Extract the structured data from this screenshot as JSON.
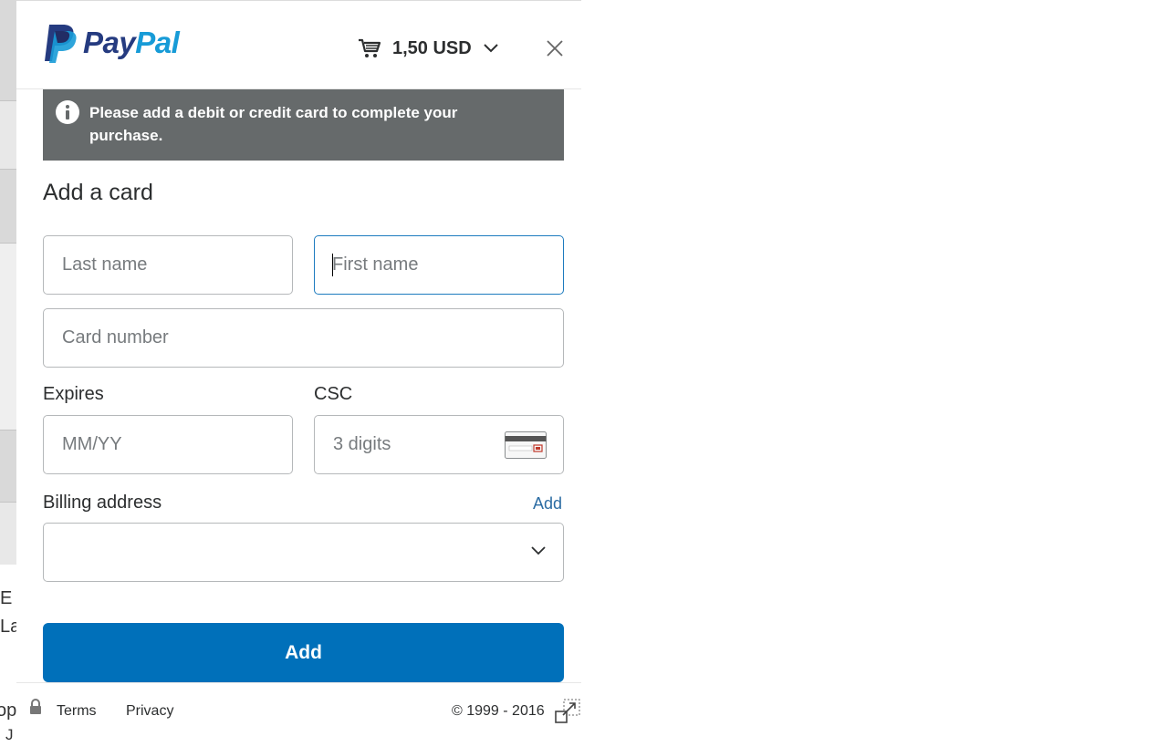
{
  "background": {
    "fragments": [
      "E",
      "La",
      "op",
      "J"
    ]
  },
  "header": {
    "logo_pay": "Pay",
    "logo_pal": "Pal",
    "cart_amount": "1,50 USD"
  },
  "alert": {
    "message": "Please add a debit or credit card to complete your purchase."
  },
  "form": {
    "title": "Add a card",
    "last_name_placeholder": "Last name",
    "first_name_placeholder": "First name",
    "card_number_placeholder": "Card number",
    "expires_label": "Expires",
    "expires_placeholder": "MM/YY",
    "csc_label": "CSC",
    "csc_placeholder": "3 digits",
    "billing_label": "Billing address",
    "billing_add_link": "Add",
    "billing_value": "",
    "submit_label": "Add"
  },
  "footer": {
    "terms": "Terms",
    "privacy": "Privacy",
    "copyright": "© 1999 - 2016"
  },
  "colors": {
    "primary": "#0070ba",
    "alert_bg": "#666a6b",
    "focus_border": "#1d7bbf",
    "link": "#2b6ca3"
  }
}
